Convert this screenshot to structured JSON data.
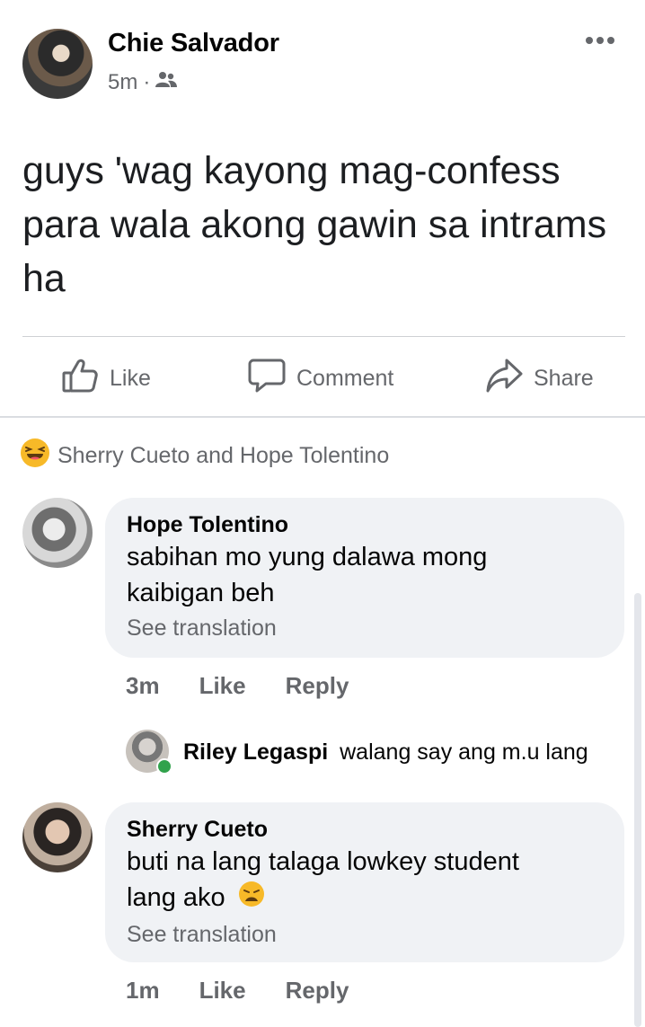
{
  "post": {
    "author": "Chie Salvador",
    "time": "5m",
    "separator": "·",
    "audience_icon": "friends-icon",
    "text": "guys 'wag kayong mag-confess para wala akong gawin sa intrams ha"
  },
  "actions": {
    "like": "Like",
    "comment": "Comment",
    "share": "Share"
  },
  "reactions": {
    "icon": "haha-reaction-icon",
    "text": "Sherry Cueto and Hope Tolentino"
  },
  "comments": [
    {
      "name": "Hope Tolentino",
      "text_line1": "sabihan mo yung dalawa mong",
      "text_line2": "kaibigan beh",
      "see_translation": "See translation",
      "time": "3m",
      "like": "Like",
      "reply": "Reply"
    },
    {
      "name": "Sherry Cueto",
      "text_line1": "buti na lang talaga lowkey student",
      "text_line2": "lang ako",
      "see_translation": "See translation",
      "time": "1m",
      "like": "Like",
      "reply": "Reply"
    }
  ],
  "reply_preview": {
    "name": "Riley Legaspi",
    "text": "walang say ang m.u lang",
    "online_color": "#31a24c"
  },
  "colors": {
    "secondary_text": "#65676b",
    "bubble_bg": "#f0f2f5"
  }
}
